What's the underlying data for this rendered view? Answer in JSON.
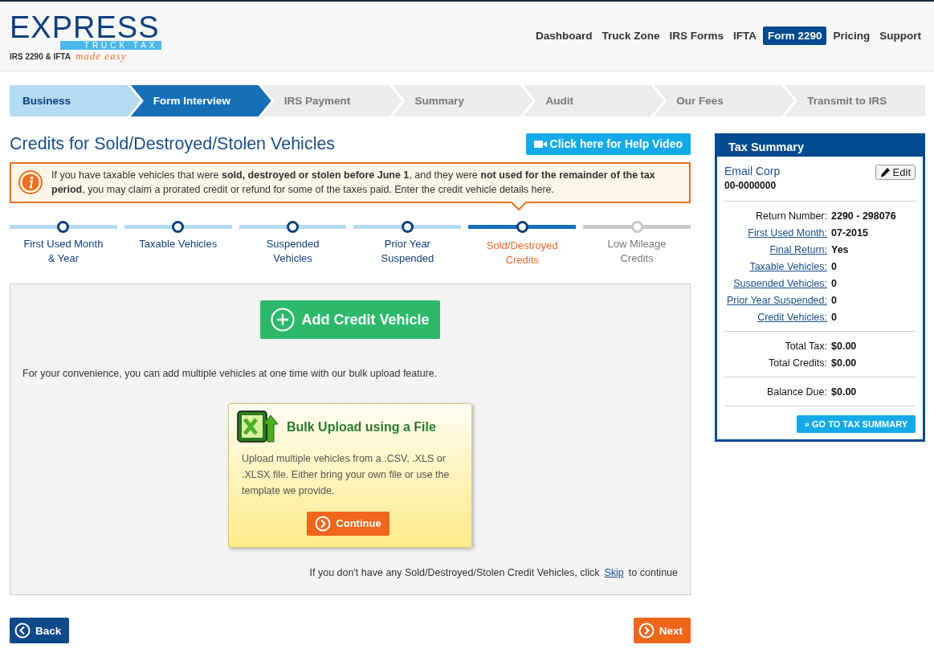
{
  "logo": {
    "word": "EXPRESS",
    "sub": "TRUCK TAX",
    "tagline": "IRS 2290 & IFTA",
    "slogan": "made easy"
  },
  "nav": [
    {
      "label": "Dashboard",
      "selected": false
    },
    {
      "label": "Truck Zone",
      "selected": false
    },
    {
      "label": "IRS Forms",
      "selected": false
    },
    {
      "label": "IFTA",
      "selected": false
    },
    {
      "label": "Form 2290",
      "selected": true
    },
    {
      "label": "Pricing",
      "selected": false
    },
    {
      "label": "Support",
      "selected": false
    }
  ],
  "wizard": [
    {
      "label": "Business",
      "completed": true,
      "selected": false
    },
    {
      "label": "Form Interview",
      "completed": false,
      "selected": true
    },
    {
      "label": "IRS Payment",
      "completed": false,
      "selected": false
    },
    {
      "label": "Summary",
      "completed": false,
      "selected": false
    },
    {
      "label": "Audit",
      "completed": false,
      "selected": false
    },
    {
      "label": "Our Fees",
      "completed": false,
      "selected": false
    },
    {
      "label": "Transmit to IRS",
      "completed": false,
      "selected": false
    }
  ],
  "page_title": "Credits for Sold/Destroyed/Stolen Vehicles",
  "help_button": "Click here for Help Video",
  "info": "If you have taxable vehicles that were **sold, destroyed or stolen before June 1**, and they were **not used for the remainder of the tax period**, you may claim a prorated credit or refund for some of the taxes paid. Enter the credit vehicle details here.",
  "substeps": [
    {
      "label": "First Used Month & Year",
      "completed": true,
      "selected": false
    },
    {
      "label": "Taxable Vehicles",
      "completed": true,
      "selected": false
    },
    {
      "label": "Suspended Vehicles",
      "completed": true,
      "selected": false
    },
    {
      "label": "Prior Year Suspended",
      "completed": true,
      "selected": false
    },
    {
      "label": "Sold/Destroyed Credits",
      "completed": false,
      "selected": true
    },
    {
      "label": "Low Mileage Credits",
      "completed": false,
      "selected": false
    }
  ],
  "add_button": "Add Credit Vehicle",
  "bulk_intro": "For your convenience, you can add multiple vehicles at one time with our bulk upload feature.",
  "bulk": {
    "title": "Bulk Upload using a File",
    "text": "Upload multiple vehicles from a .CSV, .XLS or .XLSX file. Either bring your own file or use the template we provide.",
    "button": "Continue"
  },
  "skip": {
    "before": "If you don't have any Sold/Destroyed/Stolen Credit Vehicles, click",
    "link": "Skip",
    "after": "to continue"
  },
  "back_button": "Back",
  "next_button": "Next",
  "summary": {
    "title": "Tax Summary",
    "name": "Email Corp",
    "ein": "00-0000000",
    "edit": "Edit",
    "groups": [
      [
        {
          "label": "Return Number:",
          "value": "2290 - 298076",
          "linked": false
        },
        {
          "label": "First Used Month:",
          "value": "07-2015",
          "linked": true
        },
        {
          "label": "Final Return:",
          "value": "Yes",
          "linked": true
        },
        {
          "label": "Taxable Vehicles:",
          "value": "0",
          "linked": true
        },
        {
          "label": "Suspended Vehicles:",
          "value": "0",
          "linked": true
        },
        {
          "label": "Prior Year Suspended:",
          "value": "0",
          "linked": true
        },
        {
          "label": "Credit Vehicles:",
          "value": "0",
          "linked": true
        }
      ],
      [
        {
          "label": "Total Tax:",
          "value": "$0.00",
          "linked": false
        },
        {
          "label": "Total Credits:",
          "value": "$0.00",
          "linked": false
        }
      ],
      [
        {
          "label": "Balance Due:",
          "value": "$0.00",
          "linked": false
        }
      ]
    ],
    "button": "» GO TO TAX SUMMARY"
  }
}
